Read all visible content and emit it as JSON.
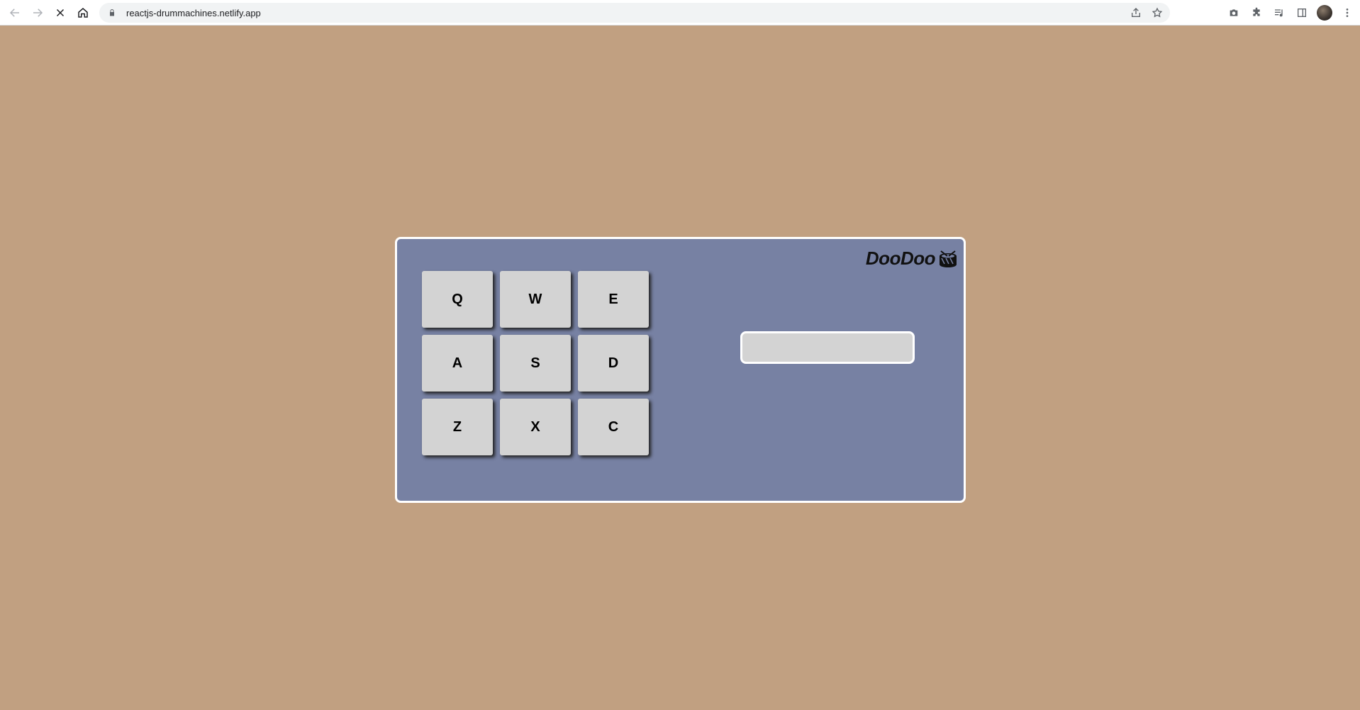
{
  "browser": {
    "url": "reactjs-drummachines.netlify.app",
    "loading": true
  },
  "drum_machine": {
    "brand_name": "DooDoo",
    "brand_icon": "drum-icon",
    "display_text": "",
    "pads": [
      {
        "key": "Q"
      },
      {
        "key": "W"
      },
      {
        "key": "E"
      },
      {
        "key": "A"
      },
      {
        "key": "S"
      },
      {
        "key": "D"
      },
      {
        "key": "Z"
      },
      {
        "key": "X"
      },
      {
        "key": "C"
      }
    ]
  },
  "colors": {
    "page_background": "#c1a081",
    "machine_background": "#7781a3",
    "pad_background": "#d3d3d3",
    "border": "#ffffff"
  }
}
